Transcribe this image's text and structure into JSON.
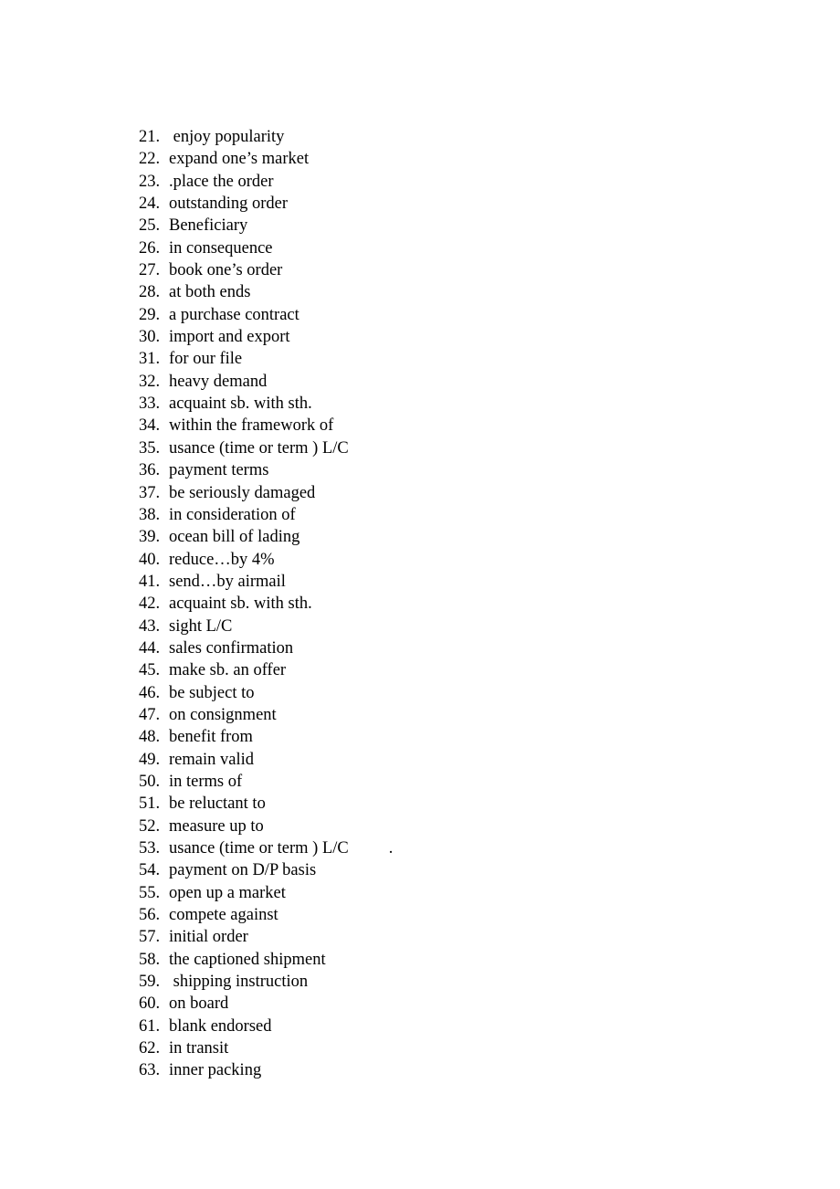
{
  "document": {
    "page_background": "#ffffff",
    "text_color": "#000000",
    "list": {
      "items": [
        {
          "number": "21.",
          "text": " enjoy popularity",
          "trailer": ""
        },
        {
          "number": "22.",
          "text": "expand one’s market",
          "trailer": ""
        },
        {
          "number": "23.",
          "text": ".place the order",
          "trailer": ""
        },
        {
          "number": "24.",
          "text": "outstanding order",
          "trailer": ""
        },
        {
          "number": "25.",
          "text": "Beneficiary",
          "trailer": ""
        },
        {
          "number": "26.",
          "text": "in consequence",
          "trailer": ""
        },
        {
          "number": "27.",
          "text": "book one’s order",
          "trailer": ""
        },
        {
          "number": "28.",
          "text": "at both ends",
          "trailer": ""
        },
        {
          "number": "29.",
          "text": "a purchase contract",
          "trailer": ""
        },
        {
          "number": "30.",
          "text": "import and export",
          "trailer": ""
        },
        {
          "number": "31.",
          "text": "for our file",
          "trailer": ""
        },
        {
          "number": "32.",
          "text": "heavy demand",
          "trailer": ""
        },
        {
          "number": "33.",
          "text": "acquaint sb. with sth.",
          "trailer": ""
        },
        {
          "number": "34.",
          "text": "within the framework of",
          "trailer": ""
        },
        {
          "number": "35.",
          "text": "usance (time or term ) L/C",
          "trailer": ""
        },
        {
          "number": "36.",
          "text": "payment terms",
          "trailer": ""
        },
        {
          "number": "37.",
          "text": "be seriously damaged",
          "trailer": ""
        },
        {
          "number": "38.",
          "text": "in consideration of",
          "trailer": ""
        },
        {
          "number": "39.",
          "text": "ocean bill of lading",
          "trailer": ""
        },
        {
          "number": "40.",
          "text": "reduce…by 4%",
          "trailer": ""
        },
        {
          "number": "41.",
          "text": "send…by airmail",
          "trailer": ""
        },
        {
          "number": "42.",
          "text": "acquaint sb. with sth.",
          "trailer": ""
        },
        {
          "number": "43.",
          "text": "sight L/C",
          "trailer": ""
        },
        {
          "number": "44.",
          "text": "sales confirmation",
          "trailer": ""
        },
        {
          "number": "45.",
          "text": "make sb. an offer",
          "trailer": ""
        },
        {
          "number": "46.",
          "text": "be subject to",
          "trailer": ""
        },
        {
          "number": "47.",
          "text": "on consignment",
          "trailer": ""
        },
        {
          "number": "48.",
          "text": "benefit from",
          "trailer": ""
        },
        {
          "number": "49.",
          "text": "remain valid",
          "trailer": ""
        },
        {
          "number": "50.",
          "text": "in terms of",
          "trailer": ""
        },
        {
          "number": "51.",
          "text": "be reluctant to",
          "trailer": ""
        },
        {
          "number": "52.",
          "text": "measure up to",
          "trailer": ""
        },
        {
          "number": "53.",
          "text": "usance (time or term ) L/C",
          "trailer": "."
        },
        {
          "number": "54.",
          "text": "payment on D/P basis",
          "trailer": ""
        },
        {
          "number": "55.",
          "text": "open up a market",
          "trailer": ""
        },
        {
          "number": "56.",
          "text": "compete against",
          "trailer": ""
        },
        {
          "number": "57.",
          "text": "initial order",
          "trailer": ""
        },
        {
          "number": "58.",
          "text": "the captioned shipment",
          "trailer": ""
        },
        {
          "number": "59.",
          "text": " shipping instruction",
          "trailer": ""
        },
        {
          "number": "60.",
          "text": "on board",
          "trailer": ""
        },
        {
          "number": "61.",
          "text": "blank endorsed",
          "trailer": ""
        },
        {
          "number": "62.",
          "text": "in transit",
          "trailer": ""
        },
        {
          "number": "63.",
          "text": "inner packing",
          "trailer": ""
        }
      ]
    }
  }
}
